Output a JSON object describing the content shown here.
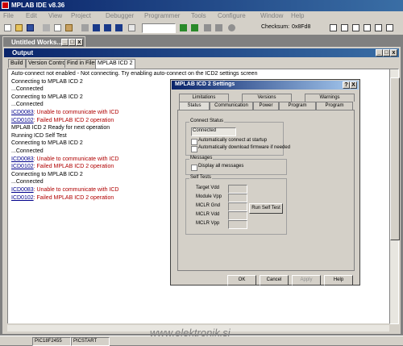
{
  "app": {
    "title": "MPLAB IDE v8.36"
  },
  "menu": [
    "File",
    "Edit",
    "View",
    "Project",
    "Debugger",
    "Programmer",
    "Tools",
    "Configure",
    "Window",
    "Help"
  ],
  "toolbar": {
    "config_combo": "",
    "checksum_label": "Checksum:",
    "checksum_value": "0x8Fd8"
  },
  "workspace": {
    "title": "Untitled Works..."
  },
  "output": {
    "title": "Output",
    "tabs": [
      "Build",
      "Version Control",
      "Find in Files",
      "MPLAB ICD 2"
    ],
    "lines": [
      {
        "text": "Auto-connect not enabled - Not connecting. Try enabling auto-connect on the ICD2 settings screen",
        "style": "normal"
      },
      {
        "text": "Connecting to MPLAB ICD 2",
        "style": "normal"
      },
      {
        "text": "...Connected",
        "style": "normal"
      },
      {
        "text": "Connecting to MPLAB ICD 2",
        "style": "normal"
      },
      {
        "text": "...Connected",
        "style": "normal"
      },
      {
        "code": "ICD0083",
        "text": ": Unable to communicate with ICD",
        "style": "red"
      },
      {
        "code": "ICD0102",
        "text": ": Failed MPLAB ICD 2 operation",
        "style": "red"
      },
      {
        "text": "MPLAB ICD 2 Ready for next operation",
        "style": "normal"
      },
      {
        "text": "Running ICD Self Test",
        "style": "normal"
      },
      {
        "text": "Connecting to MPLAB ICD 2",
        "style": "normal"
      },
      {
        "text": "...Connected",
        "style": "normal"
      },
      {
        "code": "ICD0083",
        "text": ": Unable to communicate with ICD",
        "style": "red"
      },
      {
        "code": "ICD0102",
        "text": ": Failed MPLAB ICD 2 operation",
        "style": "red"
      },
      {
        "text": "Connecting to MPLAB ICD 2",
        "style": "normal"
      },
      {
        "text": "...Connected",
        "style": "normal"
      },
      {
        "code": "ICD0083",
        "text": ": Unable to communicate with ICD",
        "style": "red"
      },
      {
        "code": "ICD0102",
        "text": ": Failed MPLAB ICD 2 operation",
        "style": "red"
      }
    ]
  },
  "dialog": {
    "title": "MPLAB ICD 2 Settings",
    "help_btn": "?",
    "close_btn": "X",
    "tabs_top": [
      "Limitations",
      "Versions",
      "Warnings"
    ],
    "tabs_bottom": [
      "Status",
      "Communication",
      "Power",
      "Program",
      "Program"
    ],
    "connect_group": "Connect Status",
    "status_value": "Connected",
    "auto_connect": "Automatically connect at startup",
    "auto_download": "Automatically download firmware if needed",
    "messages_group": "Messages",
    "display_label": "Display all messages",
    "self_test_group": "Self Tests",
    "tests": [
      "Target Vdd",
      "Module Vpp",
      "MCLR Gnd",
      "MCLR Vdd",
      "MCLR Vpp"
    ],
    "run_self_test": "Run Self Test",
    "buttons": [
      "OK",
      "Cancel",
      "Apply",
      "Help"
    ]
  },
  "status": {
    "cells": [
      "PIC18F2455",
      "PICSTART"
    ]
  },
  "watermark": "www.elektronik.si"
}
